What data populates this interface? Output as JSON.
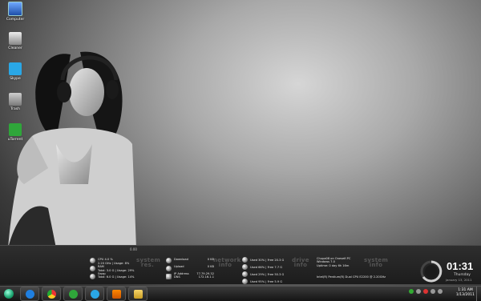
{
  "desktop": {
    "icons": [
      {
        "label": "Computer",
        "icon": "computer-icon"
      },
      {
        "label": "Cleaner",
        "icon": "cleaner-icon"
      },
      {
        "label": "Skype",
        "icon": "skype-icon"
      },
      {
        "label": "Trash",
        "icon": "recycle-bin-icon"
      },
      {
        "label": "uTorrent",
        "icon": "utorrent-icon"
      }
    ]
  },
  "panel": {
    "top_value": "0.00",
    "system_stats": {
      "title": "system res.",
      "rows": [
        [
          "CPU",
          "4.0 %"
        ],
        [
          "2.20 GHz",
          "Usage: 8%"
        ],
        [
          "RAM",
          ""
        ],
        [
          "Total: 3.0 G",
          "Usage: 29%"
        ],
        [
          "Swap",
          ""
        ],
        [
          "Total: 6.0 G",
          "Usage: 14%"
        ]
      ]
    },
    "network": {
      "title": "network info",
      "download_label": "Download",
      "download_value": "0 KB",
      "upload_label": "Upload",
      "upload_value": "0 KB",
      "ip_label": "IP Address",
      "ip_value": "77.79.29.32",
      "dns_label": "DNS",
      "dns_value": "172.16.1.1"
    },
    "drives": {
      "title": "drive info",
      "items": [
        {
          "name": "Used 30%",
          "free": "Free 20.3 G"
        },
        {
          "name": "Used 66%",
          "free": "Free 7.7 G"
        },
        {
          "name": "Used 29%",
          "free": "Free 50.3 G"
        },
        {
          "name": "Used 95%",
          "free": "Free 5.9 G"
        }
      ]
    },
    "system_info": {
      "title": "system info",
      "lines": [
        "Chupa08 on Oneself-PC",
        "Windows 7.0",
        "Uptime: 0 day 6h 16m"
      ],
      "cpu_line": "Intel(R) Pentium(R) Dual  CPU  E2200  @ 2.20GHz"
    }
  },
  "clock": {
    "time": "01:31",
    "day": "Thursday",
    "date": "January 13, 2011"
  },
  "taskbar": {
    "buttons": [
      {
        "name": "internet-explorer-button",
        "icon": "ie-icon"
      },
      {
        "name": "chrome-button",
        "icon": "chrome-icon"
      },
      {
        "name": "utorrent-button",
        "icon": "utorrent-icon"
      },
      {
        "name": "skype-button",
        "icon": "skype-icon"
      },
      {
        "name": "vlc-button",
        "icon": "vlc-icon"
      },
      {
        "name": "explorer-button",
        "icon": "folder-icon"
      }
    ],
    "tray_time": "1:31 AM",
    "tray_date": "1/13/2011"
  }
}
